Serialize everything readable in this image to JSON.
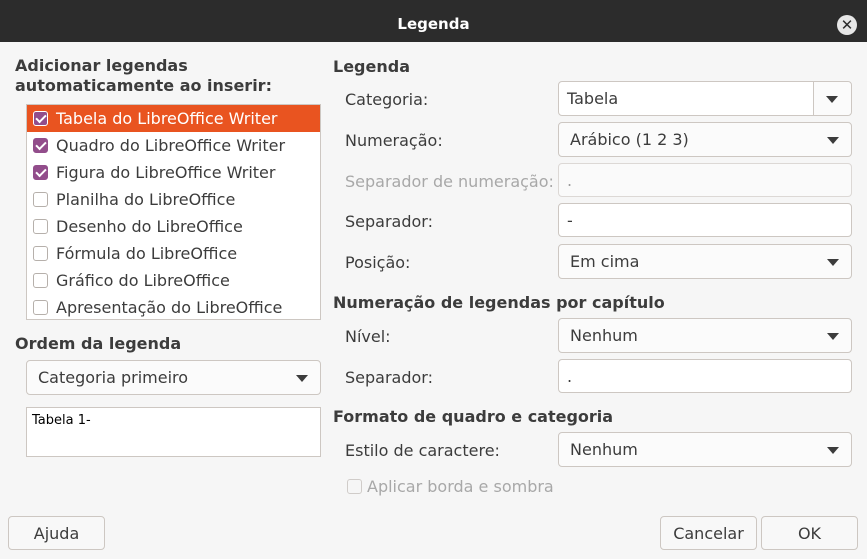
{
  "window": {
    "title": "Legenda"
  },
  "left": {
    "auto_title": "Adicionar legendas automaticamente ao inserir:",
    "items": [
      {
        "label": "Tabela do LibreOffice Writer",
        "checked": true,
        "selected": true
      },
      {
        "label": "Quadro do LibreOffice Writer",
        "checked": true,
        "selected": false
      },
      {
        "label": "Figura do LibreOffice Writer",
        "checked": true,
        "selected": false
      },
      {
        "label": "Planilha do LibreOffice",
        "checked": false,
        "selected": false
      },
      {
        "label": "Desenho do LibreOffice",
        "checked": false,
        "selected": false
      },
      {
        "label": "Fórmula do LibreOffice",
        "checked": false,
        "selected": false
      },
      {
        "label": "Gráfico do LibreOffice",
        "checked": false,
        "selected": false
      },
      {
        "label": "Apresentação do LibreOffice",
        "checked": false,
        "selected": false
      }
    ],
    "order_title": "Ordem da legenda",
    "order_value": "Categoria primeiro",
    "preview_text": "Tabela 1-"
  },
  "caption": {
    "title": "Legenda",
    "category_label": "Categoria:",
    "category_value": "Tabela",
    "numbering_label": "Numeração:",
    "numbering_value": "Arábico (1 2 3)",
    "num_sep_label": "Separador de numeração:",
    "num_sep_value": ".",
    "separator_label": "Separador:",
    "separator_value": "-",
    "position_label": "Posição:",
    "position_value": "Em cima"
  },
  "chapter": {
    "title": "Numeração de legendas por capítulo",
    "level_label": "Nível:",
    "level_value": "Nenhum",
    "separator_label": "Separador:",
    "separator_value": "."
  },
  "frame": {
    "title": "Formato de quadro e categoria",
    "char_style_label": "Estilo de caractere:",
    "char_style_value": "Nenhum",
    "border_shadow_label": "Aplicar borda e sombra"
  },
  "buttons": {
    "help": "Ajuda",
    "cancel": "Cancelar",
    "ok": "OK"
  },
  "colors": {
    "accent": "#e95420",
    "check": "#924d8b",
    "titlebar": "#2c2c2c"
  }
}
